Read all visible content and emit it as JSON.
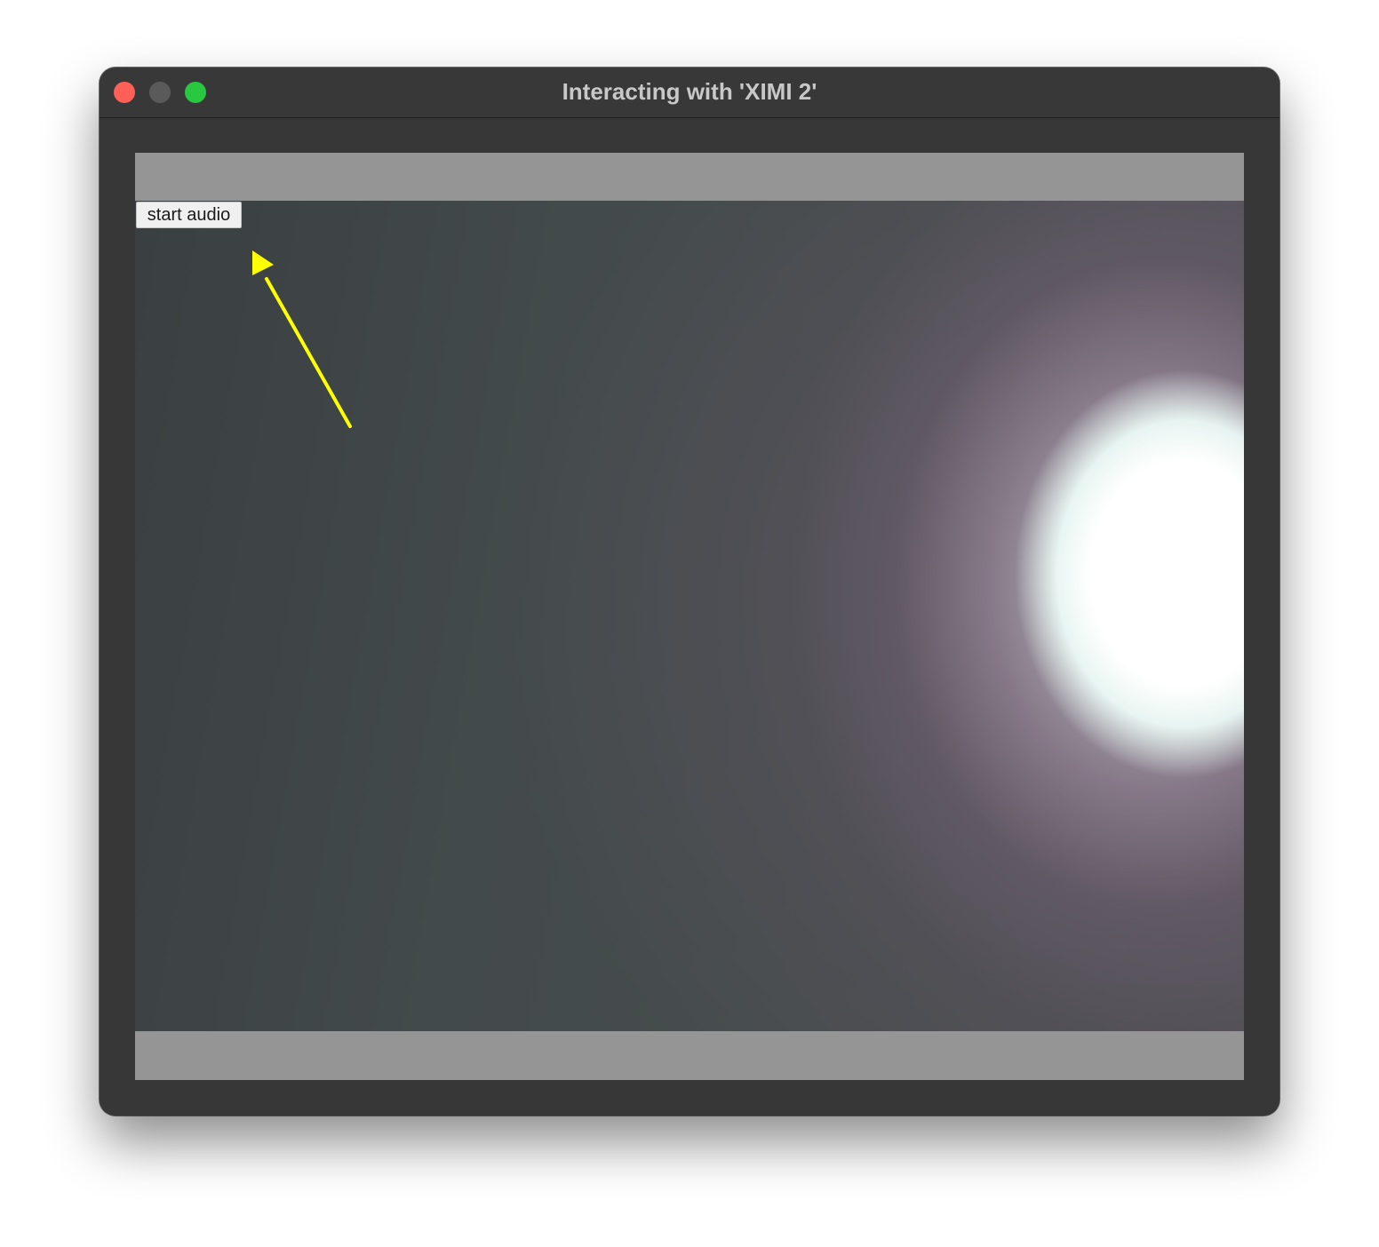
{
  "window": {
    "title": "Interacting with 'XIMI 2'"
  },
  "controls": {
    "start_audio_label": "start audio"
  },
  "colors": {
    "close": "#fe5f57",
    "minimize": "#5a5a5a",
    "zoom": "#28c840",
    "annotation_arrow": "#ffff00"
  },
  "icons": {
    "annotation": "arrow-icon"
  }
}
